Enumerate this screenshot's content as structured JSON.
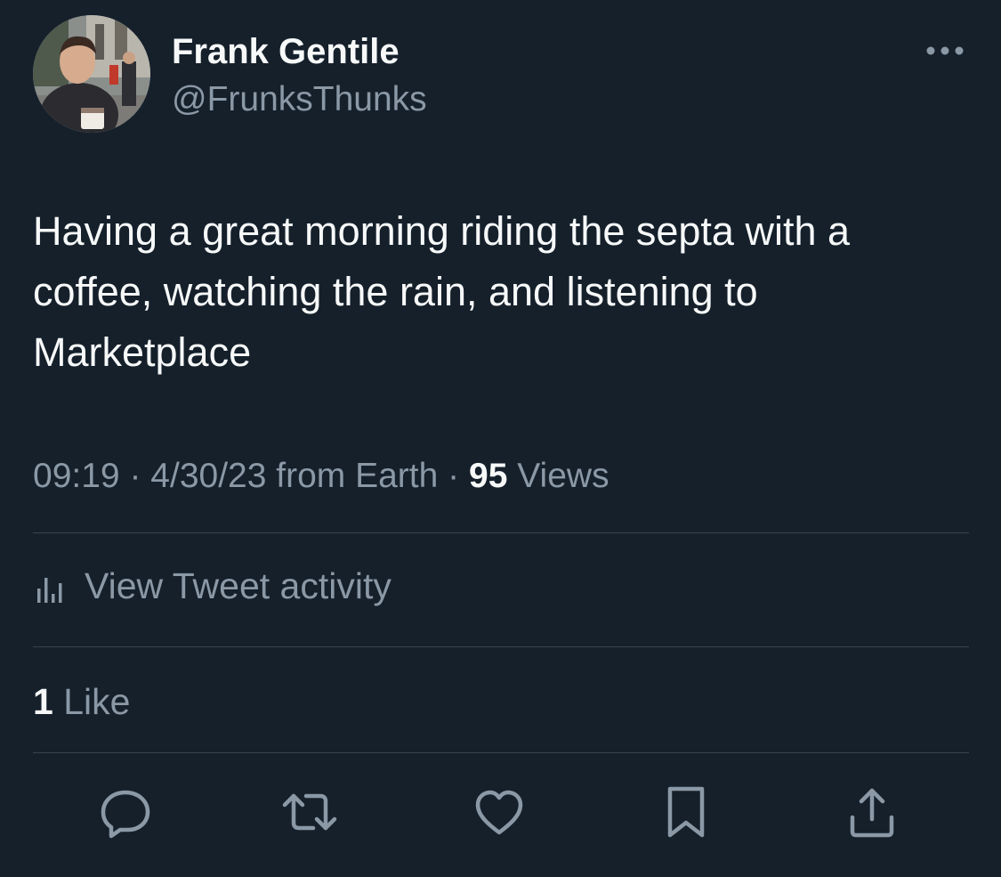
{
  "author": {
    "name": "Frank Gentile",
    "handle": "@FrunksThunks"
  },
  "tweet": {
    "text": "Having a great morning riding the septa with a coffee, watching the rain, and listening to Marketplace"
  },
  "meta": {
    "time": "09:19",
    "separator": "·",
    "date": "4/30/23",
    "source": "from Earth",
    "views_count": "95",
    "views_label": "Views"
  },
  "activity": {
    "label": "View Tweet activity"
  },
  "likes": {
    "count": "1",
    "label": "Like"
  },
  "icons": {
    "more": "more-horizontal-icon",
    "activity": "bar-chart-icon",
    "reply": "reply-bubble-icon",
    "retweet": "retweet-icon",
    "like": "heart-icon",
    "bookmark": "bookmark-icon",
    "share": "share-upload-icon"
  },
  "colors": {
    "background": "#15202b",
    "text_primary": "#f7f9f9",
    "text_secondary": "#8b98a5",
    "divider": "#38444d"
  }
}
